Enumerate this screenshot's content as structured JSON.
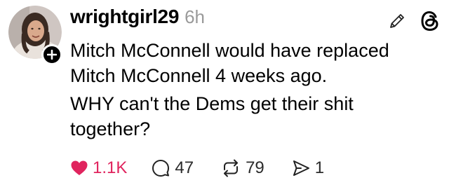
{
  "post": {
    "username": "wrightgirl29",
    "time": "6h",
    "text_lines": [
      "Mitch McConnell would have replaced Mitch McConnell  4 weeks ago.",
      "WHY can't the Dems get their shit together?"
    ]
  },
  "header_icons": [
    "edit-pencil-icon",
    "threads-logo-icon"
  ],
  "avatar": {
    "follow_badge_icon": "plus-icon"
  },
  "actions": {
    "likes": "1.1K",
    "comments": "47",
    "reposts": "79",
    "shares": "1"
  },
  "colors": {
    "like_red": "#e0245e",
    "time_gray": "#9a9a9a",
    "text": "#000000"
  }
}
